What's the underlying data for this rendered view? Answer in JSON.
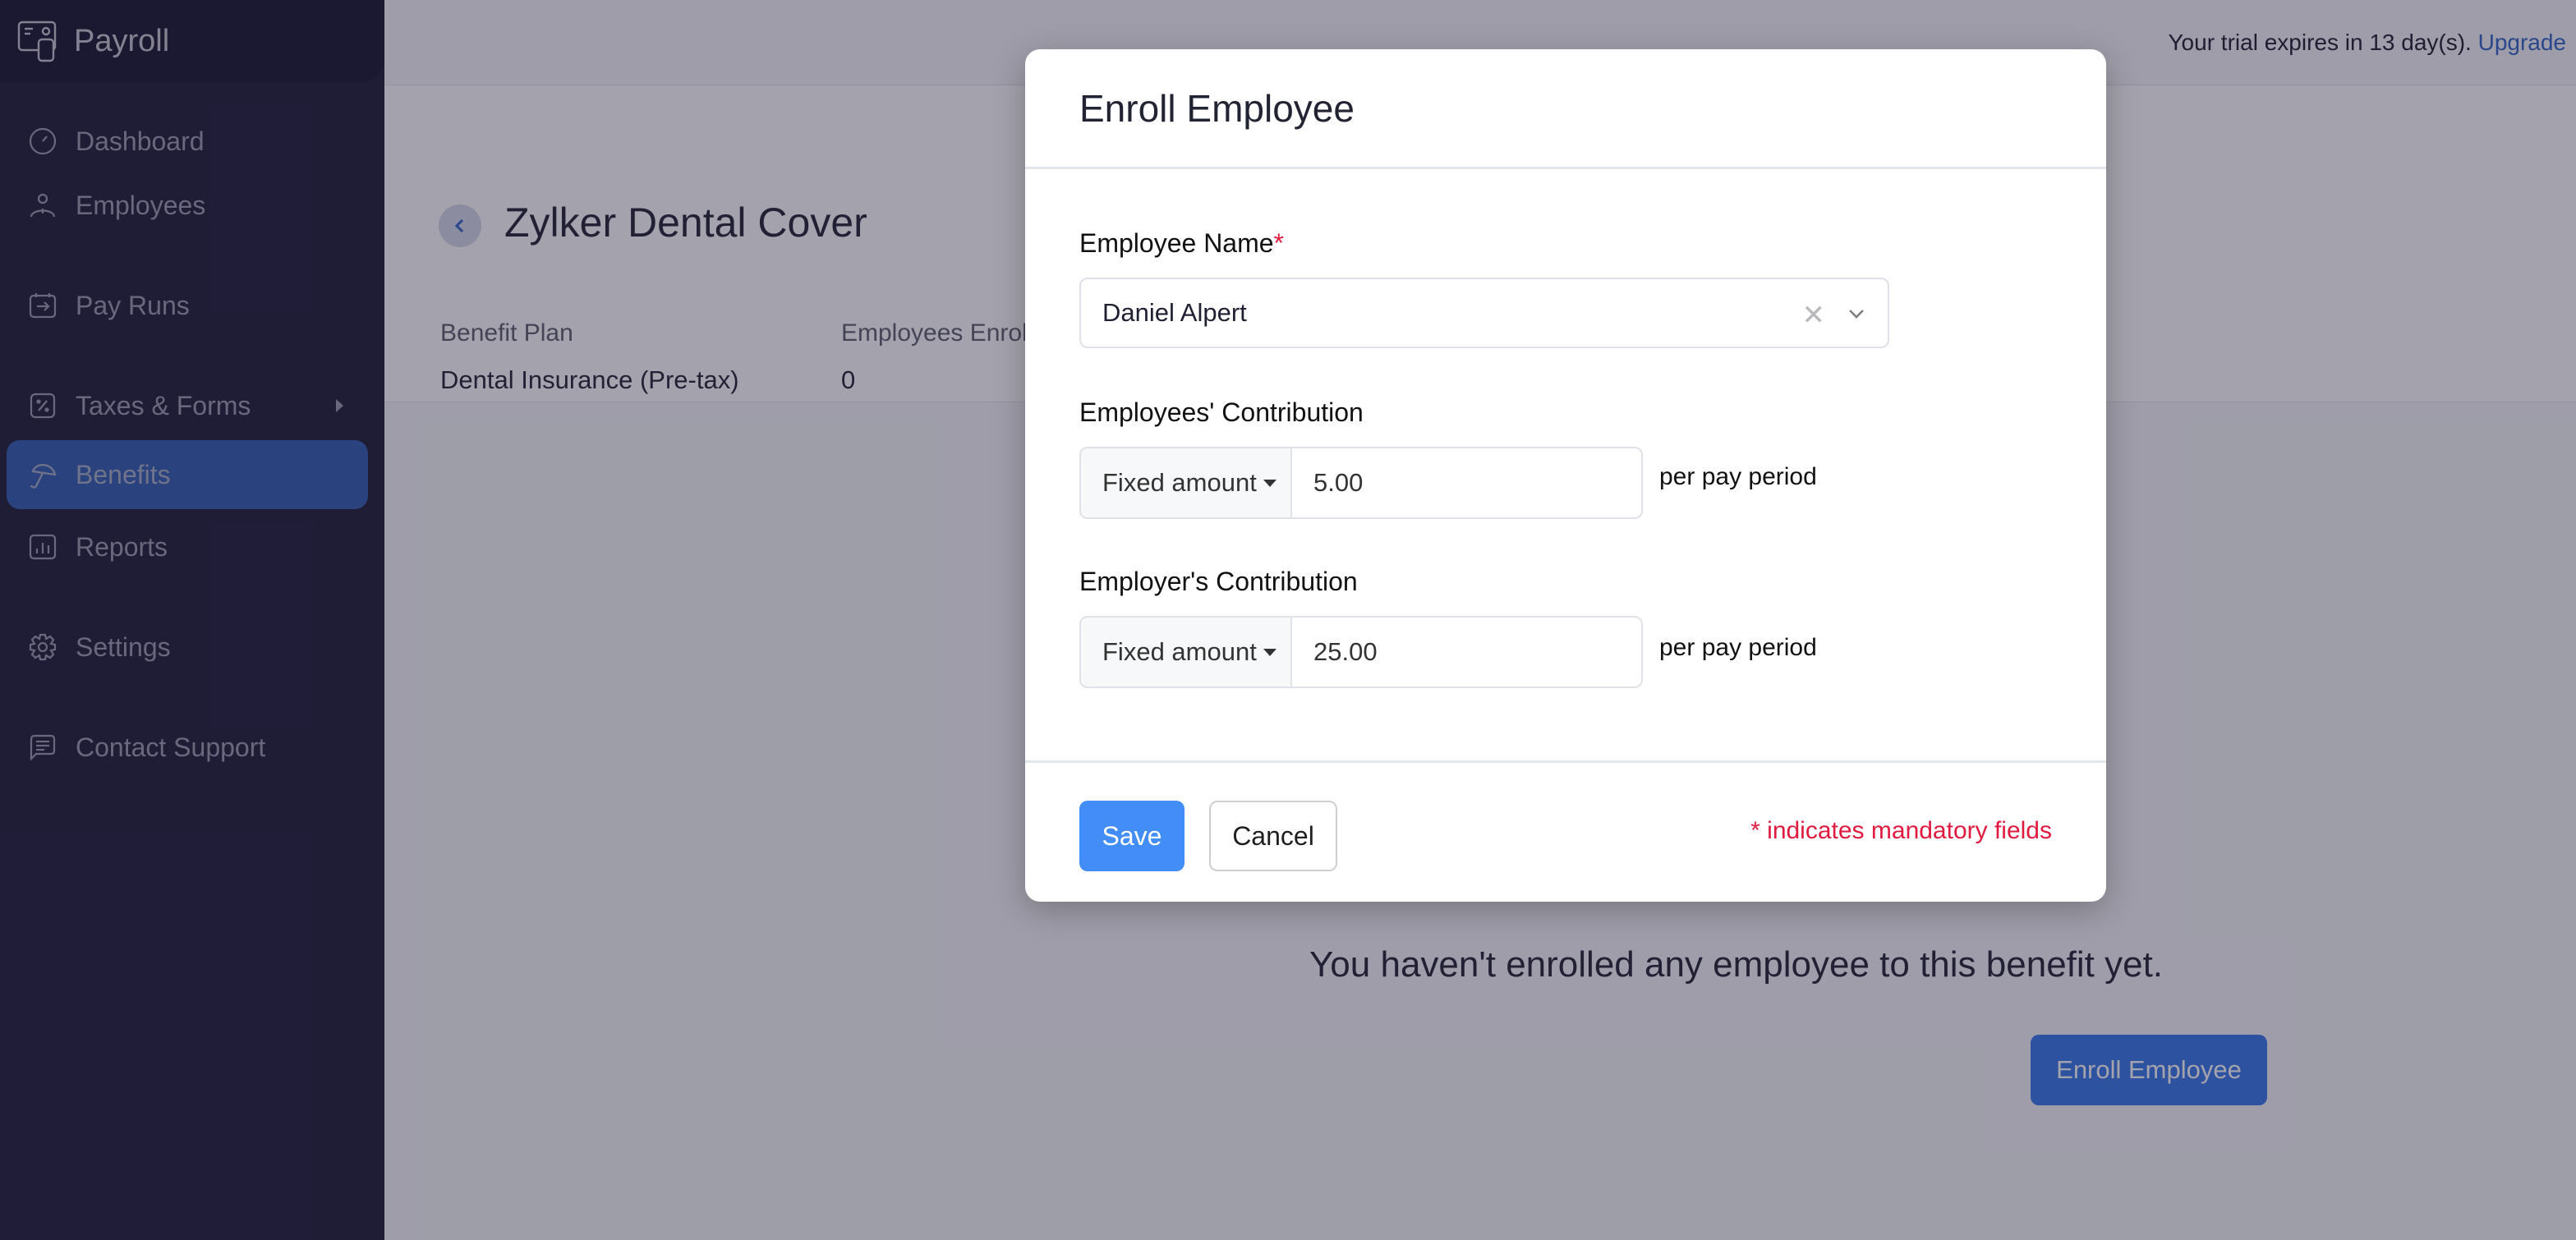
{
  "app": {
    "name": "Payroll"
  },
  "sidebar": {
    "items": [
      {
        "label": "Dashboard",
        "icon": "dashboard-gauge-icon",
        "active": false
      },
      {
        "label": "Employees",
        "icon": "person-icon",
        "active": false
      },
      {
        "label": "Pay Runs",
        "icon": "pay-run-icon",
        "active": false
      },
      {
        "label": "Taxes & Forms",
        "icon": "percent-tax-icon",
        "active": false,
        "has_submenu": true
      },
      {
        "label": "Benefits",
        "icon": "umbrella-icon",
        "active": true
      },
      {
        "label": "Reports",
        "icon": "bar-chart-icon",
        "active": false
      },
      {
        "label": "Settings",
        "icon": "gear-icon",
        "active": false
      },
      {
        "label": "Contact Support",
        "icon": "chat-icon",
        "active": false
      }
    ],
    "active_color": "#2d5bb0"
  },
  "topbar": {
    "trial_text": "Your trial expires in 13 day(s).",
    "upgrade_label": "Upgrade"
  },
  "page": {
    "title": "Zylker Dental Cover",
    "meta": [
      {
        "label": "Benefit Plan",
        "value": "Dental Insurance (Pre-tax)"
      },
      {
        "label": "Employees Enrolled",
        "value": "0"
      }
    ],
    "empty_message": "You haven't enrolled any employee to this benefit yet.",
    "enroll_button": "Enroll Employee"
  },
  "modal": {
    "title": "Enroll Employee",
    "employee_name": {
      "label": "Employee Name",
      "required_mark": "*",
      "value": "Daniel Alpert"
    },
    "employee_contribution": {
      "label": "Employees' Contribution",
      "type": "Fixed amount",
      "value": "5.00",
      "suffix": "per pay period"
    },
    "employer_contribution": {
      "label": "Employer's Contribution",
      "type": "Fixed amount",
      "value": "25.00",
      "suffix": "per pay period"
    },
    "save_label": "Save",
    "cancel_label": "Cancel",
    "mandatory_note": "* indicates mandatory fields"
  },
  "colors": {
    "primary": "#428df7",
    "required": "#e0193f",
    "link": "#2c63c4"
  }
}
